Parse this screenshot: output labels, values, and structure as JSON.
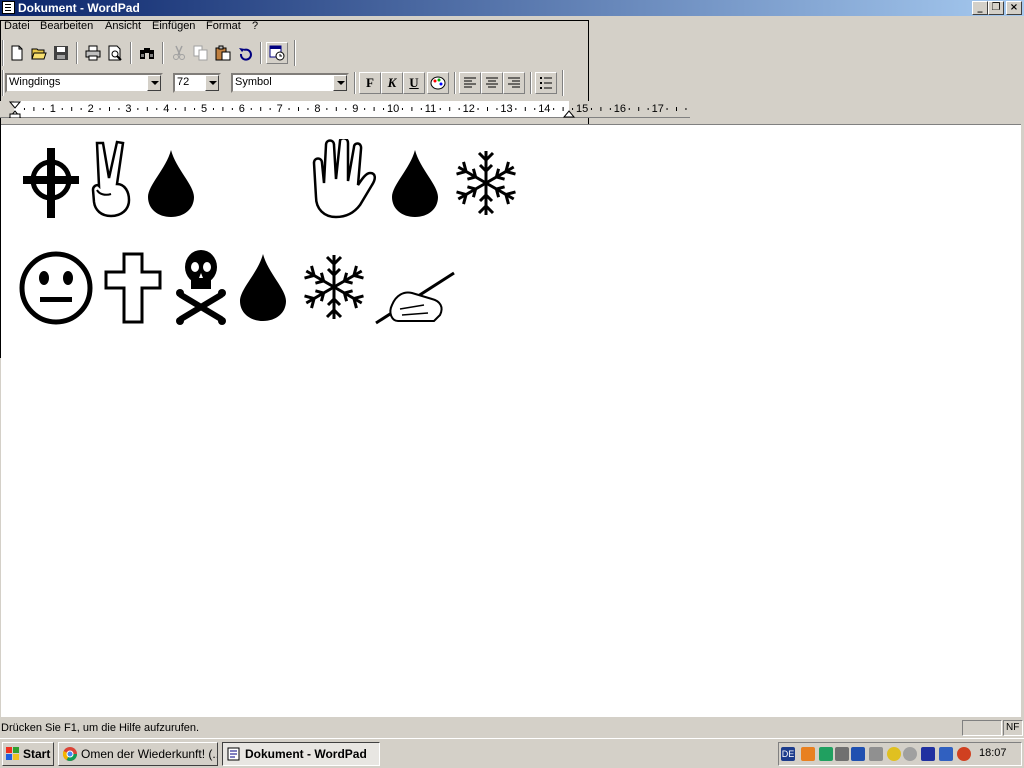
{
  "window": {
    "title": "Dokument - WordPad"
  },
  "menu": {
    "items": [
      "Datei",
      "Bearbeiten",
      "Ansicht",
      "Einfügen",
      "Format",
      "?"
    ]
  },
  "toolbar": {
    "buttons": [
      "new-document",
      "open",
      "save",
      "print",
      "print-preview",
      "find",
      "cut",
      "copy",
      "paste",
      "undo",
      "insert-date-time"
    ]
  },
  "format": {
    "font": "Wingdings",
    "size": "72",
    "script": "Symbol",
    "bold": "F",
    "italic": "K",
    "underline": "U"
  },
  "ruler": {
    "numbers": [
      "1",
      "2",
      "3",
      "4",
      "5",
      "6",
      "7",
      "8",
      "9",
      "10",
      "11",
      "12",
      "13",
      "14",
      "15",
      "16",
      "17"
    ]
  },
  "document": {
    "line1": [
      "celtic-cross",
      "victory-hand",
      "droplet",
      "space",
      "open-hand",
      "droplet",
      "snowflake"
    ],
    "line2": [
      "neutral-face",
      "latin-cross",
      "skull-and-crossbones",
      "droplet",
      "snowflake",
      "writing-hand"
    ]
  },
  "status": {
    "help_text": "Drücken Sie F1, um die Hilfe aufzurufen.",
    "mode": "NF"
  },
  "taskbar": {
    "start_label": "Start",
    "tasks": [
      "Omen der Wiederkunft! (...",
      "Dokument - WordPad"
    ],
    "language": "DE",
    "clock": "18:07"
  },
  "colors": {
    "titlebar_start": "#0a246a",
    "titlebar_end": "#a6caf0",
    "face": "#d4d0c8"
  }
}
